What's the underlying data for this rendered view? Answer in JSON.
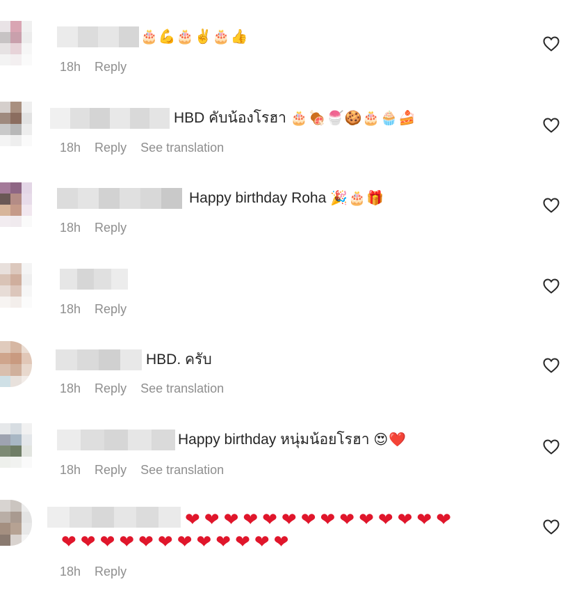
{
  "ui": {
    "reply_label": "Reply",
    "translate_label": "See translation",
    "like_icon": "heart-outline-icon",
    "meta_color": "#8e8e8e",
    "heart_color": "#e0162b"
  },
  "comments": [
    {
      "text": "",
      "emojis": "🎂💪🎂✌️🎂👍",
      "time": "18h",
      "has_translation": false
    },
    {
      "text": "HBD คับน้องโรฮา",
      "emojis": "🎂🍖🍧🍪🎂🧁🍰",
      "time": "18h",
      "has_translation": true
    },
    {
      "text": "Happy birthday Roha",
      "emojis": "🎉🎂🎁",
      "time": "18h",
      "has_translation": false
    },
    {
      "text": "",
      "emojis": "",
      "time": "18h",
      "has_translation": false
    },
    {
      "text": "HBD. ครับ",
      "emojis": "",
      "time": "18h",
      "has_translation": true
    },
    {
      "text": "Happy birthday หนุ่มน้อยโรฮา",
      "emojis": "😍❤️",
      "time": "18h",
      "has_translation": true
    },
    {
      "text": "",
      "hearts_line1": "❤❤❤❤❤❤❤❤❤❤❤❤❤❤",
      "hearts_line2": "❤❤❤❤❤❤❤❤❤❤❤❤",
      "time": "18h",
      "has_translation": false
    }
  ]
}
